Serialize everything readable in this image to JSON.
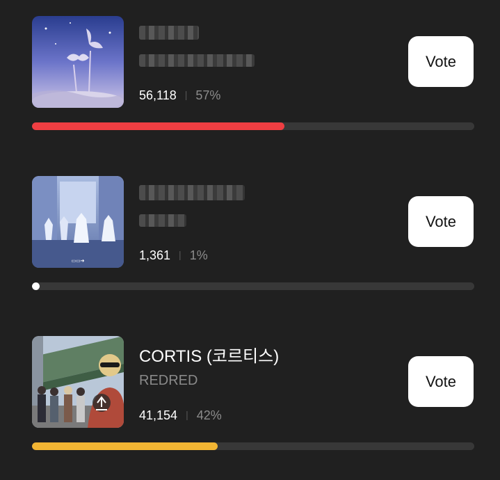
{
  "entries": [
    {
      "artist": "",
      "album": "",
      "artist_redacted": true,
      "votes": "56,118",
      "percent_label": "57%",
      "progress_fraction": 0.57,
      "vote_label": "Vote",
      "bar_color": "#ef3e42",
      "thumbnail": "fantasy-flower-artwork"
    },
    {
      "artist": "",
      "album": "",
      "artist_redacted": true,
      "votes": "1,361",
      "percent_label": "1%",
      "progress_fraction": 0.01,
      "vote_label": "Vote",
      "bar_color": "#ffffff",
      "thumbnail": "street-dancers-photo"
    },
    {
      "artist": "CORTIS (코르티스)",
      "album": "REDRED",
      "artist_redacted": false,
      "votes": "41,154",
      "percent_label": "42%",
      "progress_fraction": 0.42,
      "vote_label": "Vote",
      "bar_color": "#f2b533",
      "thumbnail": "group-photo-under-bridge"
    }
  ],
  "colors": {
    "background": "#202020",
    "track": "#383838",
    "button": "#ffffff"
  }
}
